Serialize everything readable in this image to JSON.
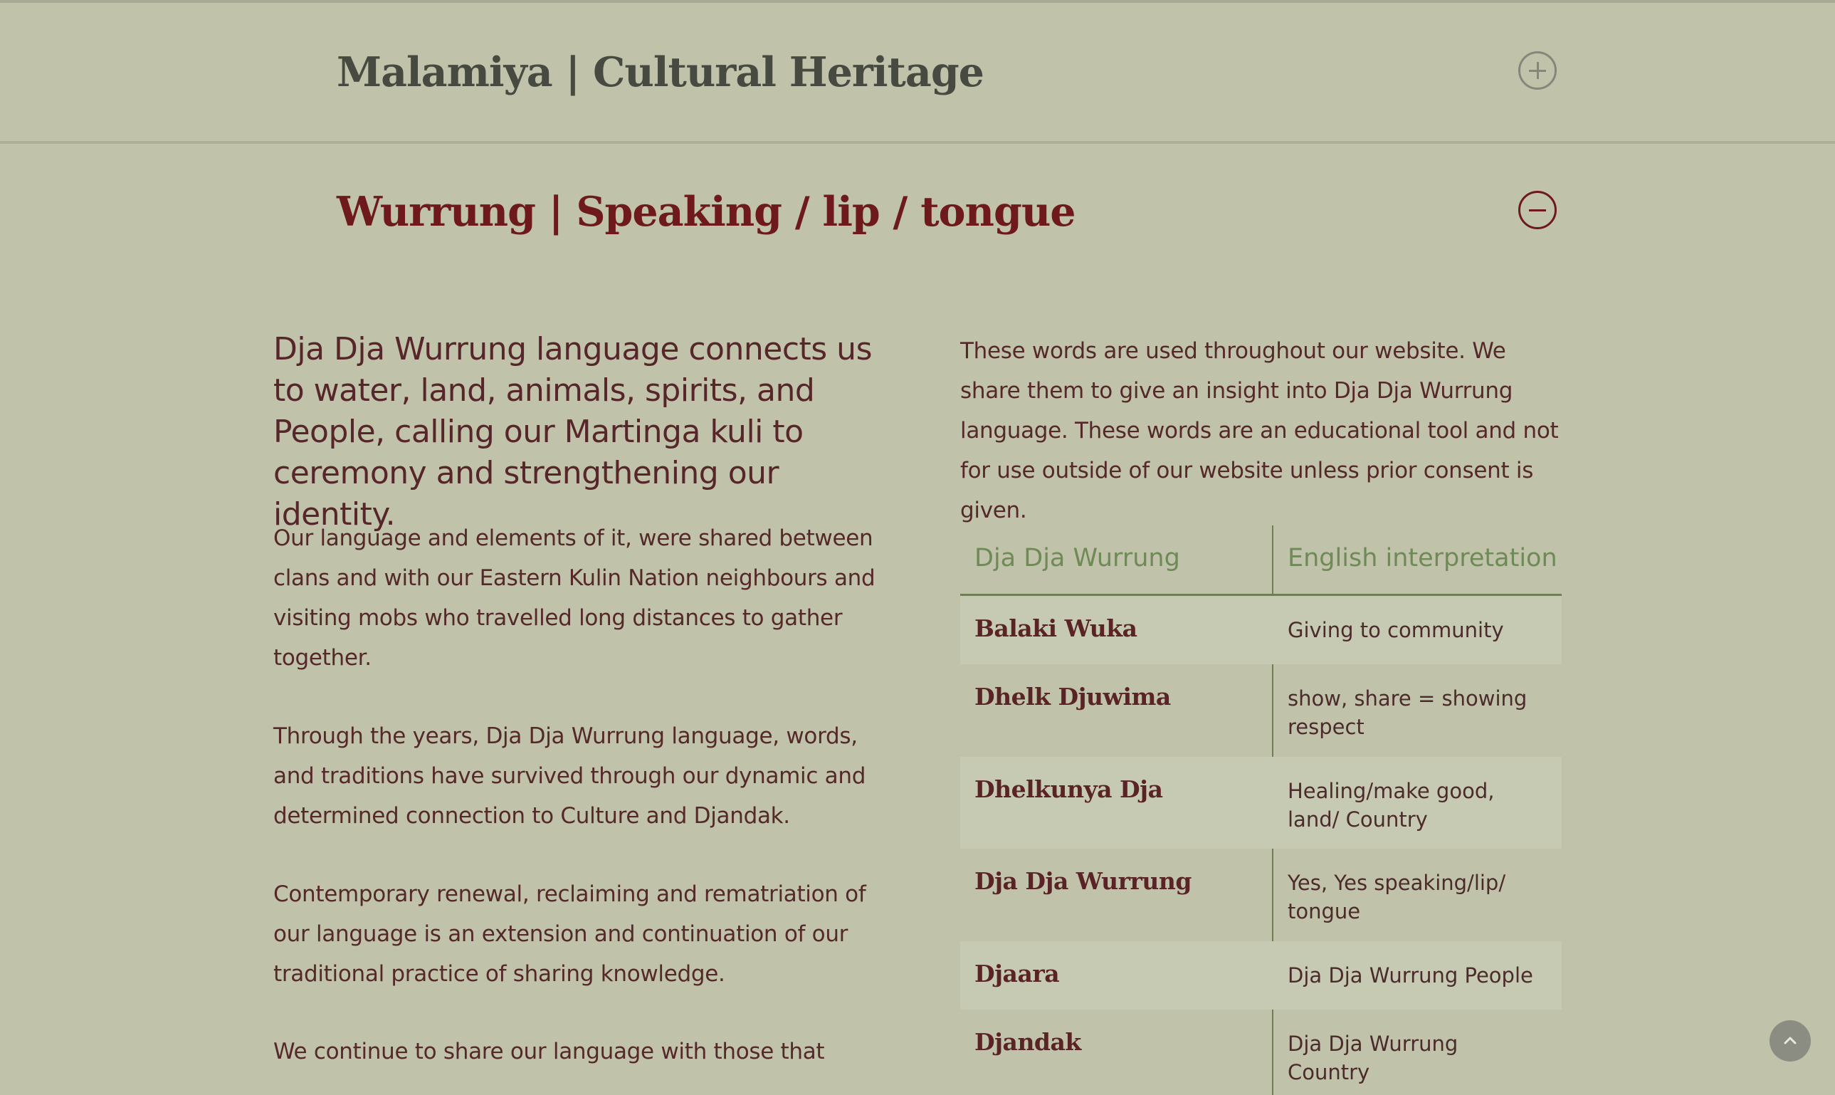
{
  "accordion": [
    {
      "title": "Malamiya | Cultural Heritage",
      "state": "collapsed",
      "toggle_icon": "plus-circle-icon"
    },
    {
      "title": "Wurrung | Speaking / lip / tongue",
      "state": "expanded",
      "toggle_icon": "minus-circle-icon"
    }
  ],
  "left_column": {
    "lead": "Dja Dja Wurrung language connects us to water, land, animals, spirits, and People, calling our Martinga kuli to ceremony and strengthening our identity.",
    "paragraphs": [
      "Our language and elements of it, were shared between clans and with our Eastern Kulin Nation neighbours and visiting mobs who travelled long distances to gather together.",
      "Through the years, Dja Dja Wurrung language, words, and traditions have survived through our dynamic and determined connection to Culture and Djandak.",
      "Contemporary renewal, reclaiming and rematriation of our language is an extension and continuation of our traditional practice of sharing knowledge.",
      "We continue to share our language with those that"
    ]
  },
  "right_column": {
    "intro": "These words are used throughout our website. We share them to give an insight into Dja Dja Wurrung language. These words are an educational tool and not for use outside of our website unless prior consent is given.",
    "table": {
      "headers": [
        "Dja Dja Wurrung",
        "English interpretation"
      ],
      "rows": [
        {
          "term": "Balaki Wuka",
          "meaning": "Giving to community"
        },
        {
          "term": "Dhelk Djuwima",
          "meaning": "show, share = showing respect"
        },
        {
          "term": "Dhelkunya Dja",
          "meaning": "Healing/make good, land/ Country"
        },
        {
          "term": "Dja Dja Wurrung",
          "meaning": "Yes, Yes speaking/lip/ tongue"
        },
        {
          "term": "Djaara",
          "meaning": "Dja Dja Wurrung People"
        },
        {
          "term": "Djandak",
          "meaning": "Dja Dja Wurrung Country"
        }
      ]
    }
  },
  "back_to_top_icon": "chevron-up-icon",
  "colors": {
    "background": "#c0c3a9",
    "heading_active": "#6e1a1c",
    "heading_inactive": "#474a40",
    "table_header": "#6f8a57",
    "body_text": "#55282a"
  }
}
